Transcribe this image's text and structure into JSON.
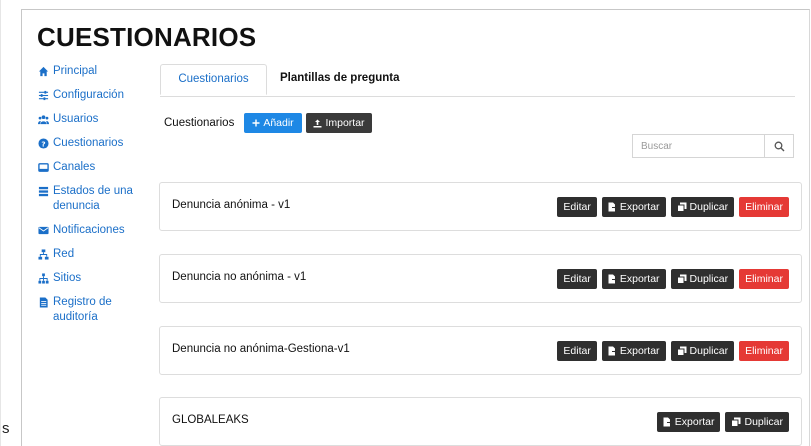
{
  "page": {
    "title": "CUESTIONARIOS",
    "stray_char": "s"
  },
  "sidebar": {
    "items": [
      {
        "label": "Principal",
        "icon": "home-icon"
      },
      {
        "label": "Configuración",
        "icon": "sliders-icon"
      },
      {
        "label": "Usuarios",
        "icon": "users-icon"
      },
      {
        "label": "Cuestionarios",
        "icon": "question-circle-icon"
      },
      {
        "label": "Canales",
        "icon": "inbox-icon"
      },
      {
        "label": "Estados de una denuncia",
        "icon": "list-icon"
      },
      {
        "label": "Notificaciones",
        "icon": "envelope-icon"
      },
      {
        "label": "Red",
        "icon": "network-icon"
      },
      {
        "label": "Sitios",
        "icon": "sitemap-icon"
      },
      {
        "label": "Registro de auditoría",
        "icon": "file-icon"
      }
    ]
  },
  "tabs": [
    {
      "label": "Cuestionarios",
      "active": true
    },
    {
      "label": "Plantillas de pregunta",
      "active": false
    }
  ],
  "toolbar": {
    "label": "Cuestionarios",
    "add_label": "Añadir",
    "import_label": "Importar"
  },
  "search": {
    "placeholder": "Buscar"
  },
  "questionnaires": [
    {
      "name": "Denuncia anónima - v1",
      "edit": "Editar",
      "export": "Exportar",
      "duplicate": "Duplicar",
      "delete": "Eliminar"
    },
    {
      "name": "Denuncia no anónima - v1",
      "edit": "Editar",
      "export": "Exportar",
      "duplicate": "Duplicar",
      "delete": "Eliminar"
    },
    {
      "name": "Denuncia no anónima-Gestiona-v1",
      "edit": "Editar",
      "export": "Exportar",
      "duplicate": "Duplicar",
      "delete": "Eliminar"
    },
    {
      "name": "GLOBALEAKS",
      "export": "Exportar",
      "duplicate": "Duplicar"
    }
  ],
  "colors": {
    "link": "#1b6fc8",
    "primary": "#1e88e5",
    "dark": "#2f2f2f",
    "danger": "#e53935"
  }
}
